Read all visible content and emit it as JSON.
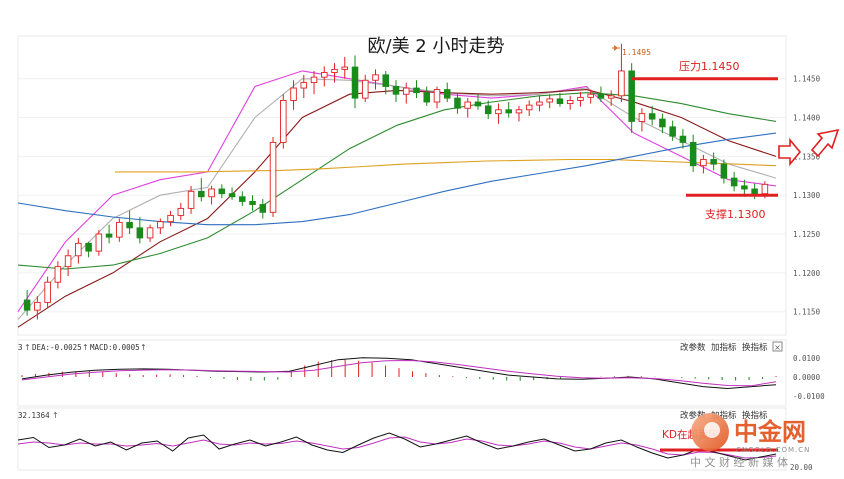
{
  "chart_data": {
    "type": "candlestick",
    "title": "欧/美 2 小时走势",
    "ylim": [
      1.112,
      1.1505
    ],
    "y_ticks": [
      "1.1450",
      "1.1400",
      "1.1350",
      "1.1300",
      "1.1250",
      "1.1200",
      "1.1150"
    ],
    "peak_label": "1.1495",
    "resistance": {
      "label": "压力1.1450",
      "value": 1.145,
      "color": "#e02020"
    },
    "support": {
      "label": "支撑1.1300",
      "value": 1.13,
      "color": "#e02020"
    },
    "candles": [
      [
        1.1165,
        1.1178,
        1.1145,
        1.1152
      ],
      [
        1.1152,
        1.117,
        1.114,
        1.1162
      ],
      [
        1.1162,
        1.1195,
        1.1155,
        1.1188
      ],
      [
        1.1188,
        1.1215,
        1.118,
        1.1208
      ],
      [
        1.1208,
        1.123,
        1.1196,
        1.1222
      ],
      [
        1.1222,
        1.1245,
        1.1212,
        1.1238
      ],
      [
        1.1238,
        1.124,
        1.122,
        1.1228
      ],
      [
        1.1228,
        1.1255,
        1.1222,
        1.125
      ],
      [
        1.125,
        1.1262,
        1.1238,
        1.1246
      ],
      [
        1.1246,
        1.127,
        1.124,
        1.1265
      ],
      [
        1.1265,
        1.128,
        1.125,
        1.1258
      ],
      [
        1.1258,
        1.1272,
        1.1238,
        1.1245
      ],
      [
        1.1245,
        1.1262,
        1.124,
        1.1258
      ],
      [
        1.1258,
        1.127,
        1.125,
        1.1266
      ],
      [
        1.1266,
        1.128,
        1.126,
        1.1274
      ],
      [
        1.1274,
        1.129,
        1.1268,
        1.1283
      ],
      [
        1.1283,
        1.1312,
        1.1276,
        1.1305
      ],
      [
        1.1305,
        1.1322,
        1.1292,
        1.1298
      ],
      [
        1.1298,
        1.1312,
        1.1288,
        1.1308
      ],
      [
        1.1308,
        1.1314,
        1.1296,
        1.1302
      ],
      [
        1.1302,
        1.131,
        1.1294,
        1.1298
      ],
      [
        1.1298,
        1.1305,
        1.1286,
        1.1292
      ],
      [
        1.1292,
        1.13,
        1.128,
        1.1288
      ],
      [
        1.1288,
        1.1295,
        1.127,
        1.1278
      ],
      [
        1.1278,
        1.1375,
        1.1272,
        1.1368
      ],
      [
        1.1368,
        1.143,
        1.136,
        1.1422
      ],
      [
        1.1422,
        1.1448,
        1.141,
        1.1438
      ],
      [
        1.1438,
        1.1455,
        1.1425,
        1.1445
      ],
      [
        1.1445,
        1.146,
        1.143,
        1.1452
      ],
      [
        1.1452,
        1.1466,
        1.144,
        1.1458
      ],
      [
        1.1458,
        1.147,
        1.1445,
        1.1462
      ],
      [
        1.1462,
        1.1478,
        1.145,
        1.1465
      ],
      [
        1.1465,
        1.148,
        1.1412,
        1.1425
      ],
      [
        1.1425,
        1.1455,
        1.142,
        1.1448
      ],
      [
        1.1448,
        1.1462,
        1.1436,
        1.1455
      ],
      [
        1.1455,
        1.146,
        1.143,
        1.144
      ],
      [
        1.144,
        1.1448,
        1.142,
        1.143
      ],
      [
        1.143,
        1.1445,
        1.1418,
        1.1438
      ],
      [
        1.1438,
        1.1448,
        1.1425,
        1.1432
      ],
      [
        1.1432,
        1.144,
        1.1415,
        1.142
      ],
      [
        1.142,
        1.144,
        1.1412,
        1.1436
      ],
      [
        1.1436,
        1.1445,
        1.142,
        1.1425
      ],
      [
        1.1425,
        1.1432,
        1.1405,
        1.1412
      ],
      [
        1.1412,
        1.1425,
        1.14,
        1.142
      ],
      [
        1.142,
        1.143,
        1.141,
        1.1415
      ],
      [
        1.1415,
        1.1422,
        1.1398,
        1.1405
      ],
      [
        1.1405,
        1.1418,
        1.1392,
        1.141
      ],
      [
        1.141,
        1.142,
        1.14,
        1.1406
      ],
      [
        1.1406,
        1.1415,
        1.1395,
        1.141
      ],
      [
        1.141,
        1.1422,
        1.1402,
        1.1416
      ],
      [
        1.1416,
        1.1428,
        1.1408,
        1.142
      ],
      [
        1.142,
        1.143,
        1.1412,
        1.1424
      ],
      [
        1.1424,
        1.1432,
        1.1414,
        1.1418
      ],
      [
        1.1418,
        1.1428,
        1.141,
        1.1422
      ],
      [
        1.1422,
        1.1433,
        1.1414,
        1.1426
      ],
      [
        1.1426,
        1.1436,
        1.1418,
        1.143
      ],
      [
        1.143,
        1.144,
        1.142,
        1.1425
      ],
      [
        1.1425,
        1.1435,
        1.1415,
        1.1428
      ],
      [
        1.1428,
        1.1495,
        1.142,
        1.146
      ],
      [
        1.146,
        1.147,
        1.138,
        1.1395
      ],
      [
        1.1395,
        1.1412,
        1.1382,
        1.1405
      ],
      [
        1.1405,
        1.1415,
        1.139,
        1.1398
      ],
      [
        1.1398,
        1.1405,
        1.138,
        1.1388
      ],
      [
        1.1388,
        1.1396,
        1.137,
        1.1376
      ],
      [
        1.1376,
        1.1385,
        1.136,
        1.1368
      ],
      [
        1.1368,
        1.1378,
        1.133,
        1.1338
      ],
      [
        1.1338,
        1.1352,
        1.1328,
        1.1346
      ],
      [
        1.1346,
        1.1355,
        1.1332,
        1.134
      ],
      [
        1.134,
        1.1346,
        1.1315,
        1.1322
      ],
      [
        1.1322,
        1.133,
        1.1305,
        1.1312
      ],
      [
        1.1312,
        1.132,
        1.1298,
        1.1308
      ],
      [
        1.1308,
        1.1315,
        1.1295,
        1.1302
      ],
      [
        1.1302,
        1.1318,
        1.1296,
        1.1314
      ]
    ],
    "ma_lines": [
      {
        "color": "#e040e0",
        "values": [
          1.115,
          1.124,
          1.13,
          1.132,
          1.133,
          1.144,
          1.146,
          1.145,
          1.144,
          1.143,
          1.1425,
          1.143,
          1.144,
          1.138,
          1.135,
          1.132,
          1.1312
        ]
      },
      {
        "color": "#b0b0b0",
        "values": [
          1.114,
          1.121,
          1.127,
          1.13,
          1.131,
          1.14,
          1.145,
          1.1448,
          1.144,
          1.1432,
          1.1428,
          1.143,
          1.1438,
          1.14,
          1.137,
          1.134,
          1.1322
        ]
      },
      {
        "color": "#8b1a1a",
        "values": [
          1.113,
          1.117,
          1.12,
          1.124,
          1.127,
          1.133,
          1.14,
          1.143,
          1.1435,
          1.1432,
          1.143,
          1.1432,
          1.1436,
          1.142,
          1.14,
          1.137,
          1.135
        ]
      },
      {
        "color": "#2e8b2e",
        "values": [
          1.121,
          1.1205,
          1.121,
          1.1225,
          1.1245,
          1.128,
          1.132,
          1.136,
          1.139,
          1.141,
          1.142,
          1.1428,
          1.1432,
          1.1428,
          1.1418,
          1.1405,
          1.1395
        ]
      },
      {
        "color": "#e0a020",
        "values": [
          1.133,
          1.133,
          1.133,
          1.1331,
          1.1332,
          1.1334,
          1.1337,
          1.134,
          1.1342,
          1.1344,
          1.1345,
          1.1346,
          1.1346,
          1.1344,
          1.1342,
          1.134,
          1.1338
        ]
      },
      {
        "color": "#3070c0",
        "values": [
          1.129,
          1.128,
          1.1272,
          1.1266,
          1.1262,
          1.1262,
          1.1266,
          1.1275,
          1.129,
          1.1305,
          1.1318,
          1.1328,
          1.1338,
          1.135,
          1.1362,
          1.1372,
          1.138
        ]
      }
    ],
    "macd": {
      "header_lead": "3",
      "dea_label": "DEA:-0.0025",
      "macd_label": "MACD:0.0005",
      "ylim": [
        -0.013,
        0.013
      ],
      "y_ticks": [
        "0.0100",
        "0.0000",
        "-0.0100"
      ],
      "hist": [
        0.001,
        0.0016,
        0.0022,
        0.0028,
        0.003,
        0.0032,
        0.0026,
        0.002,
        0.0014,
        0.001,
        0.0012,
        0.0014,
        0.001,
        0.0006,
        -0.0004,
        -0.001,
        -0.0016,
        -0.002,
        -0.0018,
        -0.0014,
        0.003,
        0.006,
        0.008,
        0.0088,
        0.009,
        0.0085,
        0.0075,
        0.006,
        0.0046,
        0.003,
        0.002,
        0.001,
        0.0004,
        -0.0006,
        -0.001,
        -0.0014,
        -0.0018,
        -0.002,
        -0.0016,
        -0.0012,
        -0.0008,
        -0.0004,
        0.0,
        0.0002,
        0.0004,
        0.0006,
        0.0004,
        0.0002,
        0.0,
        -0.0004,
        -0.0008,
        -0.0012,
        -0.0016,
        -0.0018,
        -0.0016,
        -0.001,
        0.0005
      ],
      "dif": [
        -0.001,
        0.001,
        0.0025,
        0.0035,
        0.004,
        0.0042,
        0.004,
        0.0035,
        0.003,
        0.0028,
        0.0026,
        0.003,
        0.006,
        0.009,
        0.01,
        0.0098,
        0.009,
        0.007,
        0.005,
        0.003,
        0.001,
        0.0,
        -0.001,
        -0.0012,
        -0.0006,
        0.0,
        -0.001,
        -0.003,
        -0.005,
        -0.006,
        -0.005,
        -0.004
      ],
      "dea": [
        -0.0015,
        0.0,
        0.0015,
        0.0025,
        0.0032,
        0.0036,
        0.0038,
        0.0036,
        0.0033,
        0.003,
        0.0028,
        0.0026,
        0.0035,
        0.0055,
        0.0075,
        0.0085,
        0.0086,
        0.0078,
        0.0064,
        0.0047,
        0.003,
        0.0016,
        0.0004,
        -0.0004,
        -0.0006,
        -0.0004,
        -0.0008,
        -0.0018,
        -0.0032,
        -0.0044,
        -0.0045,
        -0.0025
      ]
    },
    "kd": {
      "header_value": "32.1364",
      "ylim": [
        10,
        110
      ],
      "y_tick": "20.00",
      "k": [
        70,
        75,
        55,
        60,
        72,
        58,
        66,
        50,
        64,
        68,
        48,
        74,
        80,
        52,
        62,
        70,
        58,
        66,
        76,
        60,
        50,
        45,
        60,
        74,
        84,
        72,
        56,
        62,
        70,
        78,
        64,
        52,
        58,
        66,
        72,
        60,
        48,
        52,
        64,
        70,
        56,
        44,
        34,
        40,
        52,
        46,
        38,
        30,
        36,
        42
      ],
      "d": [
        62,
        66,
        64,
        60,
        64,
        62,
        62,
        58,
        60,
        63,
        58,
        64,
        70,
        62,
        60,
        64,
        62,
        63,
        68,
        64,
        58,
        52,
        55,
        64,
        74,
        76,
        66,
        62,
        65,
        72,
        68,
        60,
        58,
        62,
        68,
        64,
        56,
        52,
        58,
        64,
        60,
        52,
        42,
        40,
        46,
        45,
        40,
        34,
        35,
        38
      ]
    },
    "panel_buttons": [
      "改参数",
      "加指标",
      "换指标",
      "×"
    ],
    "kd_buttons": [
      "改参数",
      "加指标",
      "换指标"
    ],
    "kd_annotation": "KD在超卖区",
    "watermark": {
      "brand": "中金网",
      "latin": "CNGOLD.COM.CN",
      "tagline": "中 文 财 经 新 媒 体"
    }
  }
}
